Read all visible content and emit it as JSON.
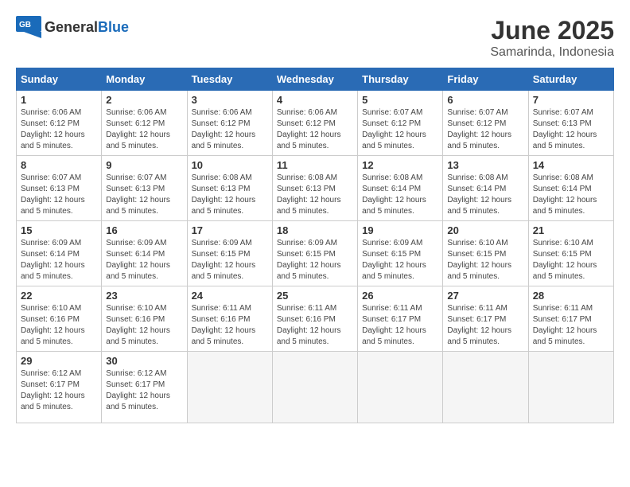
{
  "logo": {
    "text_general": "General",
    "text_blue": "Blue"
  },
  "title": "June 2025",
  "subtitle": "Samarinda, Indonesia",
  "days_header": [
    "Sunday",
    "Monday",
    "Tuesday",
    "Wednesday",
    "Thursday",
    "Friday",
    "Saturday"
  ],
  "weeks": [
    [
      {
        "day": "1",
        "sunrise": "6:06 AM",
        "sunset": "6:12 PM",
        "daylight": "12 hours and 5 minutes."
      },
      {
        "day": "2",
        "sunrise": "6:06 AM",
        "sunset": "6:12 PM",
        "daylight": "12 hours and 5 minutes."
      },
      {
        "day": "3",
        "sunrise": "6:06 AM",
        "sunset": "6:12 PM",
        "daylight": "12 hours and 5 minutes."
      },
      {
        "day": "4",
        "sunrise": "6:06 AM",
        "sunset": "6:12 PM",
        "daylight": "12 hours and 5 minutes."
      },
      {
        "day": "5",
        "sunrise": "6:07 AM",
        "sunset": "6:12 PM",
        "daylight": "12 hours and 5 minutes."
      },
      {
        "day": "6",
        "sunrise": "6:07 AM",
        "sunset": "6:12 PM",
        "daylight": "12 hours and 5 minutes."
      },
      {
        "day": "7",
        "sunrise": "6:07 AM",
        "sunset": "6:13 PM",
        "daylight": "12 hours and 5 minutes."
      }
    ],
    [
      {
        "day": "8",
        "sunrise": "6:07 AM",
        "sunset": "6:13 PM",
        "daylight": "12 hours and 5 minutes."
      },
      {
        "day": "9",
        "sunrise": "6:07 AM",
        "sunset": "6:13 PM",
        "daylight": "12 hours and 5 minutes."
      },
      {
        "day": "10",
        "sunrise": "6:08 AM",
        "sunset": "6:13 PM",
        "daylight": "12 hours and 5 minutes."
      },
      {
        "day": "11",
        "sunrise": "6:08 AM",
        "sunset": "6:13 PM",
        "daylight": "12 hours and 5 minutes."
      },
      {
        "day": "12",
        "sunrise": "6:08 AM",
        "sunset": "6:14 PM",
        "daylight": "12 hours and 5 minutes."
      },
      {
        "day": "13",
        "sunrise": "6:08 AM",
        "sunset": "6:14 PM",
        "daylight": "12 hours and 5 minutes."
      },
      {
        "day": "14",
        "sunrise": "6:08 AM",
        "sunset": "6:14 PM",
        "daylight": "12 hours and 5 minutes."
      }
    ],
    [
      {
        "day": "15",
        "sunrise": "6:09 AM",
        "sunset": "6:14 PM",
        "daylight": "12 hours and 5 minutes."
      },
      {
        "day": "16",
        "sunrise": "6:09 AM",
        "sunset": "6:14 PM",
        "daylight": "12 hours and 5 minutes."
      },
      {
        "day": "17",
        "sunrise": "6:09 AM",
        "sunset": "6:15 PM",
        "daylight": "12 hours and 5 minutes."
      },
      {
        "day": "18",
        "sunrise": "6:09 AM",
        "sunset": "6:15 PM",
        "daylight": "12 hours and 5 minutes."
      },
      {
        "day": "19",
        "sunrise": "6:09 AM",
        "sunset": "6:15 PM",
        "daylight": "12 hours and 5 minutes."
      },
      {
        "day": "20",
        "sunrise": "6:10 AM",
        "sunset": "6:15 PM",
        "daylight": "12 hours and 5 minutes."
      },
      {
        "day": "21",
        "sunrise": "6:10 AM",
        "sunset": "6:15 PM",
        "daylight": "12 hours and 5 minutes."
      }
    ],
    [
      {
        "day": "22",
        "sunrise": "6:10 AM",
        "sunset": "6:16 PM",
        "daylight": "12 hours and 5 minutes."
      },
      {
        "day": "23",
        "sunrise": "6:10 AM",
        "sunset": "6:16 PM",
        "daylight": "12 hours and 5 minutes."
      },
      {
        "day": "24",
        "sunrise": "6:11 AM",
        "sunset": "6:16 PM",
        "daylight": "12 hours and 5 minutes."
      },
      {
        "day": "25",
        "sunrise": "6:11 AM",
        "sunset": "6:16 PM",
        "daylight": "12 hours and 5 minutes."
      },
      {
        "day": "26",
        "sunrise": "6:11 AM",
        "sunset": "6:17 PM",
        "daylight": "12 hours and 5 minutes."
      },
      {
        "day": "27",
        "sunrise": "6:11 AM",
        "sunset": "6:17 PM",
        "daylight": "12 hours and 5 minutes."
      },
      {
        "day": "28",
        "sunrise": "6:11 AM",
        "sunset": "6:17 PM",
        "daylight": "12 hours and 5 minutes."
      }
    ],
    [
      {
        "day": "29",
        "sunrise": "6:12 AM",
        "sunset": "6:17 PM",
        "daylight": "12 hours and 5 minutes."
      },
      {
        "day": "30",
        "sunrise": "6:12 AM",
        "sunset": "6:17 PM",
        "daylight": "12 hours and 5 minutes."
      },
      null,
      null,
      null,
      null,
      null
    ]
  ]
}
